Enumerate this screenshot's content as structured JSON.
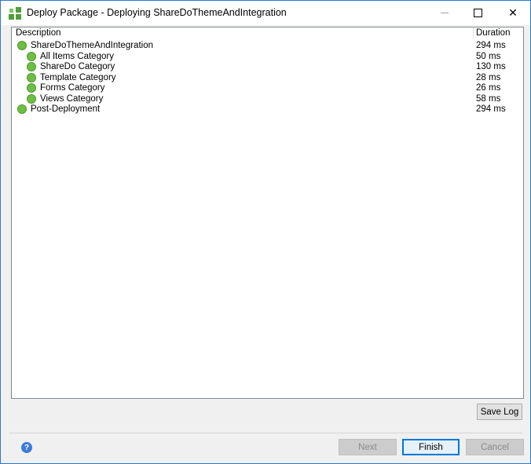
{
  "window": {
    "title": "Deploy Package - Deploying ShareDoThemeAndIntegration",
    "minimize_glyph": "—",
    "maximize_glyph": "☐",
    "close_glyph": "✕"
  },
  "log": {
    "columns": {
      "description": "Description",
      "duration": "Duration"
    },
    "rows": [
      {
        "description": "ShareDoThemeAndIntegration",
        "duration": "294 ms",
        "status": "success"
      },
      {
        "description": "All Items Category",
        "duration": "50 ms",
        "status": "success"
      },
      {
        "description": "ShareDo Category",
        "duration": "130 ms",
        "status": "success"
      },
      {
        "description": "Template Category",
        "duration": "28 ms",
        "status": "success"
      },
      {
        "description": "Forms Category",
        "duration": "26 ms",
        "status": "success"
      },
      {
        "description": "Views Category",
        "duration": "58 ms",
        "status": "success"
      },
      {
        "description": "Post-Deployment",
        "duration": "294 ms",
        "status": "success"
      }
    ]
  },
  "buttons": {
    "save_log": "Save Log",
    "next": "Next",
    "finish": "Finish",
    "cancel": "Cancel"
  },
  "help_glyph": "?",
  "colors": {
    "accent": "#0078d7",
    "success": "#6fbe44",
    "app_icon": "#4f9e3b"
  }
}
